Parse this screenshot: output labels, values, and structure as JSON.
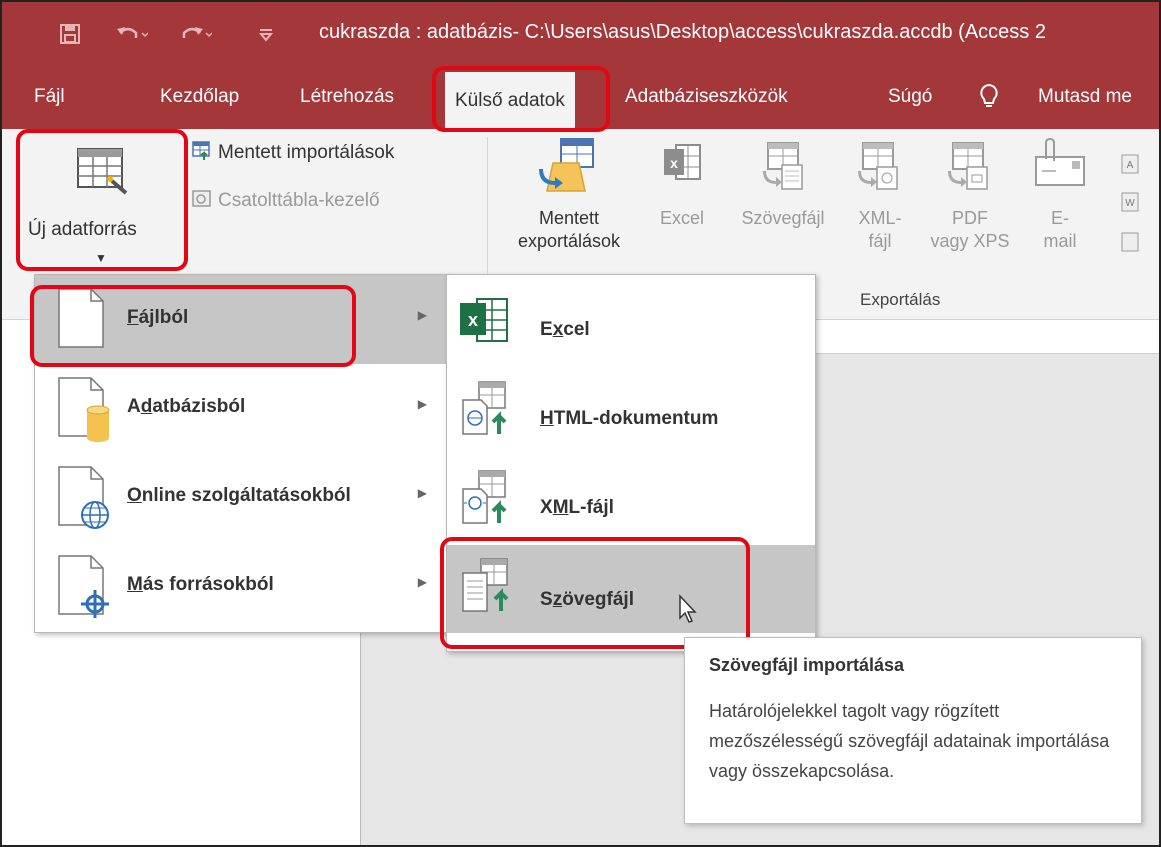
{
  "window": {
    "title": "cukraszda : adatbázis- C:\\Users\\asus\\Desktop\\access\\cukraszda.accdb (Access 2"
  },
  "quick_access": [
    "save-icon",
    "undo-icon",
    "redo-icon",
    "customize-icon"
  ],
  "tabs": [
    {
      "label": "Fájl"
    },
    {
      "label": "Kezdőlap"
    },
    {
      "label": "Létrehozás"
    },
    {
      "label": "Külső adatok",
      "active": true
    },
    {
      "label": "Adatbáziseszközök"
    },
    {
      "label": "Súgó"
    },
    {
      "label": "Mutasd me"
    }
  ],
  "ribbon": {
    "new_source": {
      "label": "Új adatforrás"
    },
    "saved_imports": "Mentett importálások",
    "linked_table_manager": "Csatolttábla-kezelő",
    "export_buttons": [
      {
        "line1": "Mentett",
        "line2": "exportálások",
        "enabled": true
      },
      {
        "line1": "Excel",
        "line2": "",
        "enabled": false
      },
      {
        "line1": "Szövegfájl",
        "line2": "",
        "enabled": false
      },
      {
        "line1": "XML-",
        "line2": "fájl",
        "enabled": false
      },
      {
        "line1": "PDF",
        "line2": "vagy XPS",
        "enabled": false
      },
      {
        "line1": "E-",
        "line2": "mail",
        "enabled": false
      }
    ],
    "export_group_label": "Exportálás"
  },
  "menu_sources": [
    {
      "label": "Fájlból",
      "underline": "F",
      "rest": "ájlból",
      "highlighted": true
    },
    {
      "label": "Adatbázisból",
      "pre": "A",
      "underline": "d",
      "rest": "atbázisból"
    },
    {
      "label": "Online szolgáltatásokból",
      "underline": "O",
      "rest": "nline szolgáltatásokból"
    },
    {
      "label": "Más forrásokból",
      "underline": "M",
      "rest": "ás forrásokból"
    }
  ],
  "menu_file_types": [
    {
      "label": "Excel",
      "pre": "E",
      "underline": "x",
      "rest": "cel"
    },
    {
      "label": "HTML-dokumentum",
      "underline": "H",
      "rest": "TML-dokumentum"
    },
    {
      "label": "XML-fájl",
      "pre": "X",
      "underline": "M",
      "rest": "L-fájl"
    },
    {
      "label": "Szövegfájl",
      "pre": "S",
      "underline": "z",
      "rest": "övegfájl",
      "highlighted": true
    }
  ],
  "tooltip": {
    "title": "Szövegfájl importálása",
    "body": "Határolójelekkel tagolt vagy rögzített mezőszélességű szövegfájl adatainak importálása vagy összekapcsolása."
  },
  "colors": {
    "accent": "#a4373a",
    "highlight_box": "#e30613",
    "excel_green": "#1e7145",
    "menu_hover": "#c6c6c6"
  }
}
